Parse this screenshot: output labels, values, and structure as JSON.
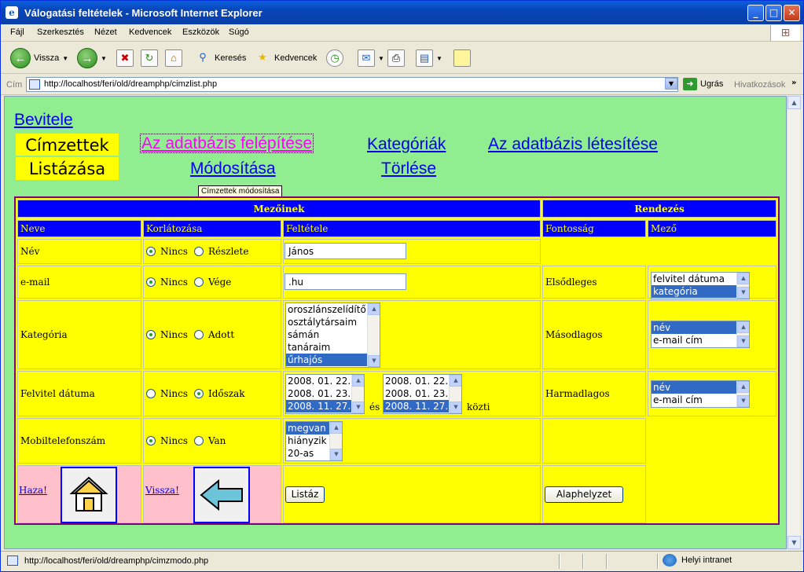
{
  "window": {
    "title": "Válogatási feltételek - Microsoft Internet Explorer"
  },
  "menu": [
    "Fájl",
    "Szerkesztés",
    "Nézet",
    "Kedvencek",
    "Eszközök",
    "Súgó"
  ],
  "toolbar": {
    "back": "Vissza",
    "search": "Keresés",
    "favorites": "Kedvencek"
  },
  "address": {
    "label": "Cím",
    "url": "http://localhost/feri/old/dreamphp/cimzlist.php",
    "go": "Ugrás",
    "links": "Hivatkozások"
  },
  "status": {
    "text": "http://localhost/feri/old/dreamphp/cimzmodo.php",
    "zone": "Helyi intranet"
  },
  "nav": {
    "bevitele": "Bevitele",
    "cimzettek": "Címzettek",
    "listazasa": "Listázása",
    "felepites": "Az adatbázis felépítése",
    "modositasa": "Módosítása",
    "kategoriak": "Kategóriák",
    "torlese": "Törlése",
    "letesites": "Az adatbázis létesítése",
    "tooltip": "Címzettek módosítása"
  },
  "table": {
    "hdr_mezoinek": "Mezőinek",
    "hdr_rendezes": "Rendezés",
    "col_neve": "Neve",
    "col_korlat": "Korlátozása",
    "col_felt": "Feltétele",
    "col_fontossag": "Fontosság",
    "col_mezo": "Mező",
    "rows": {
      "nev": {
        "label": "Név",
        "r1": "Nincs",
        "r2": "Részlete",
        "value": "János"
      },
      "email": {
        "label": "e-mail",
        "r1": "Nincs",
        "r2": "Vége",
        "value": ".hu",
        "prio": "Elsődleges",
        "opts": [
          "felvitel dátuma",
          "kategória"
        ]
      },
      "kat": {
        "label": "Kategória",
        "r1": "Nincs",
        "r2": "Adott",
        "opts": [
          "oroszlánszelídítő",
          "osztálytársaim",
          "sámán",
          "tanáraim",
          "űrhajós"
        ],
        "prio": "Másodlagos",
        "sortopts": [
          "név",
          "e-mail cím"
        ]
      },
      "felv": {
        "label": "Felvitel dátuma",
        "r1": "Nincs",
        "r2": "Időszak",
        "opts": [
          "2008. 01. 22.",
          "2008. 01. 23.",
          "2008. 11. 27."
        ],
        "es": "és",
        "kozti": "közti",
        "prio": "Harmadlagos",
        "sortopts": [
          "név",
          "e-mail cím"
        ]
      },
      "mobil": {
        "label": "Mobiltelefonszám",
        "r1": "Nincs",
        "r2": "Van",
        "opts": [
          "megvan",
          "hiányzik",
          "20-as"
        ]
      }
    },
    "haza": "Haza!",
    "vissza": "Vissza!",
    "listaz": "Listáz",
    "alaphelyzet": "Alaphelyzet"
  }
}
